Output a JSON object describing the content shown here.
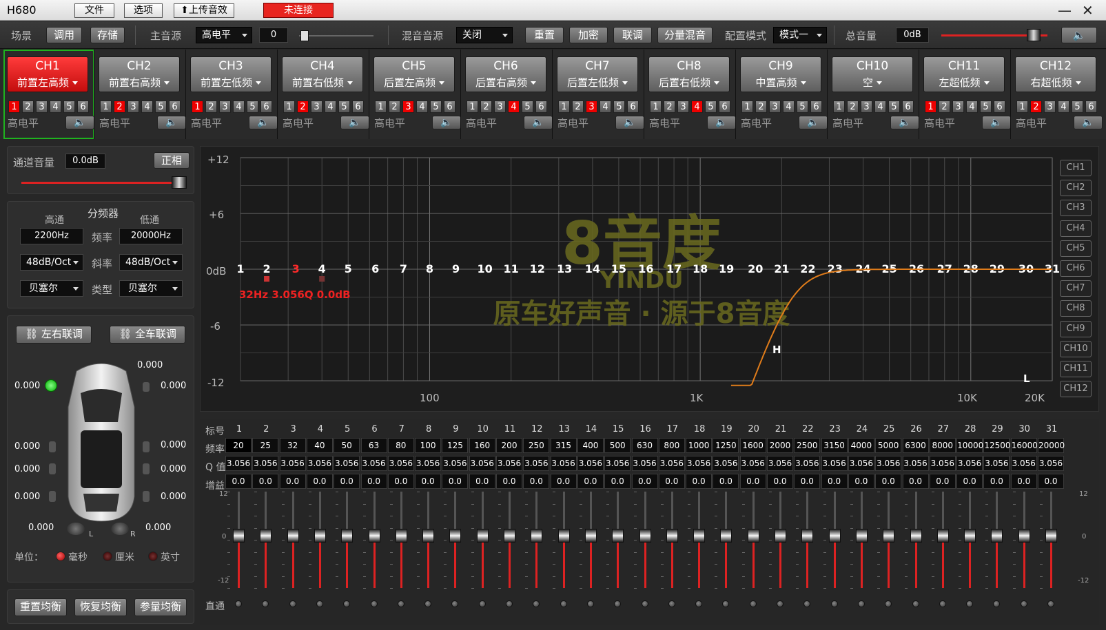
{
  "window": {
    "title": "H680",
    "menu": [
      "文件",
      "选项",
      "上传音效"
    ],
    "status": "未连接",
    "min": "—",
    "close": "✕"
  },
  "topbar": {
    "scene_label": "场景",
    "tune": "调用",
    "store": "存储",
    "main_source_label": "主音源",
    "main_source": "高电平",
    "main_level": "0",
    "mix_source_label": "混音音源",
    "mix_source": "关闭",
    "reset": "重置",
    "encrypt": "加密",
    "link": "联调",
    "split_mix": "分量混音",
    "config_label": "配置模式",
    "config": "模式一",
    "master_label": "总音量",
    "master": "0dB"
  },
  "channels": [
    {
      "name": "CH1",
      "pos": "前置左高频",
      "active": [
        1
      ]
    },
    {
      "name": "CH2",
      "pos": "前置右高频",
      "active": [
        2
      ]
    },
    {
      "name": "CH3",
      "pos": "前置左低频",
      "active": [
        1
      ]
    },
    {
      "name": "CH4",
      "pos": "前置右低频",
      "active": [
        2
      ]
    },
    {
      "name": "CH5",
      "pos": "后置左高频",
      "active": [
        3
      ]
    },
    {
      "name": "CH6",
      "pos": "后置右高频",
      "active": [
        4
      ]
    },
    {
      "name": "CH7",
      "pos": "后置左低频",
      "active": [
        3
      ]
    },
    {
      "name": "CH8",
      "pos": "后置右低频",
      "active": [
        4
      ]
    },
    {
      "name": "CH9",
      "pos": "中置高频",
      "active": []
    },
    {
      "name": "CH10",
      "pos": "空",
      "active": []
    },
    {
      "name": "CH11",
      "pos": "左超低频",
      "active": [
        1
      ]
    },
    {
      "name": "CH12",
      "pos": "右超低频",
      "active": [
        2
      ]
    }
  ],
  "channel_gain_label": "高电平",
  "left": {
    "ch_vol_label": "通道音量",
    "ch_vol": "0.0dB",
    "phase": "正相",
    "xover_title": "分频器",
    "hp": "高通",
    "lp": "低通",
    "freq_label": "频率",
    "hp_freq": "2200Hz",
    "lp_freq": "20000Hz",
    "slope_label": "斜率",
    "hp_slope": "48dB/Oct",
    "lp_slope": "48dB/Oct",
    "type_label": "类型",
    "hp_type": "贝塞尔",
    "lp_type": "贝塞尔",
    "lr_link": "左右联调",
    "all_link": "全车联调",
    "delays": [
      "0.000",
      "0.000",
      "0.000",
      "0.000",
      "0.000",
      "0.000",
      "0.000",
      "0.000",
      "0.000",
      "0.000",
      "0.000"
    ],
    "spk_l": "L",
    "spk_r": "R",
    "unit_label": "单位：",
    "units": [
      "毫秒",
      "厘米",
      "英寸"
    ],
    "reset_eq": "重置均衡",
    "restore_eq": "恢复均衡",
    "bypass_eq": "参量均衡"
  },
  "graph": {
    "y_labels": [
      "+12",
      "+6",
      "0dB",
      "-6",
      "-12"
    ],
    "x_labels": [
      "100",
      "1K",
      "10K",
      "20K"
    ],
    "marker_info": "32Hz 3.056Q 0.0dB",
    "h_label": "H",
    "l_label": "L",
    "watermark_logo": "8音度",
    "watermark_sub": "YINDU",
    "watermark_text": "原车好声音 · 源于8音度",
    "legend": [
      "CH1",
      "CH2",
      "CH3",
      "CH4",
      "CH5",
      "CH6",
      "CH7",
      "CH8",
      "CH9",
      "CH10",
      "CH11",
      "CH12"
    ],
    "band_numbers": [
      "1",
      "2",
      "3",
      "4",
      "5",
      "6",
      "7",
      "8",
      "9",
      "10",
      "11",
      "12",
      "13",
      "14",
      "15",
      "16",
      "17",
      "18",
      "19",
      "20",
      "21",
      "22",
      "23",
      "24",
      "25",
      "26",
      "27",
      "28",
      "29",
      "30",
      "31"
    ],
    "highlight_band": "3"
  },
  "eq_table": {
    "row_labels": [
      "标号",
      "频率",
      "Q 值",
      "增益"
    ],
    "bypass_label": "直通",
    "scale_top": "12",
    "scale_mid": "0",
    "scale_bot": "-12",
    "freqs": [
      "20",
      "25",
      "32",
      "40",
      "50",
      "63",
      "80",
      "100",
      "125",
      "160",
      "200",
      "250",
      "315",
      "400",
      "500",
      "630",
      "800",
      "1000",
      "1250",
      "1600",
      "2000",
      "2500",
      "3150",
      "4000",
      "5000",
      "6300",
      "8000",
      "10000",
      "12500",
      "16000",
      "20000"
    ],
    "q": "3.056",
    "gain": "0.0"
  },
  "colors": {
    "accent_red": "#e8241f",
    "curve": "#e07c1a",
    "watermark": "#6a6a1f"
  }
}
